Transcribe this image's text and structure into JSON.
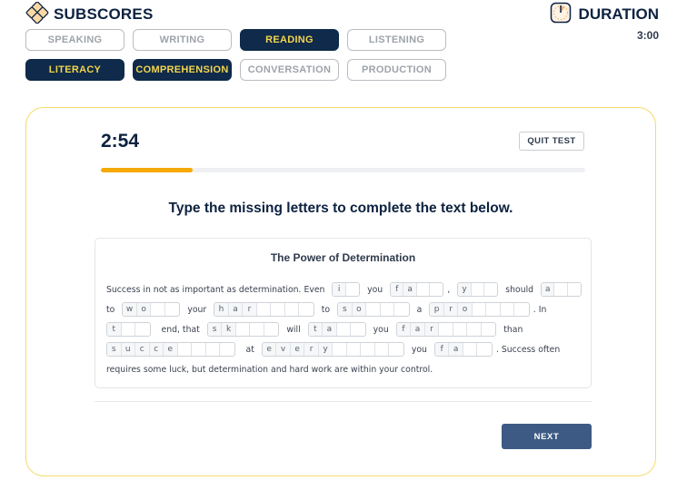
{
  "header": {
    "subscores_title": "SUBSCORES",
    "subscores_icon": "diamond-grid-icon",
    "duration_title": "DURATION",
    "duration_icon": "stopwatch-icon",
    "duration_value": "3:00"
  },
  "pills_row1": [
    {
      "label": "SPEAKING",
      "active": false
    },
    {
      "label": "WRITING",
      "active": false
    },
    {
      "label": "READING",
      "active": true
    },
    {
      "label": "LISTENING",
      "active": false
    }
  ],
  "pills_row2": [
    {
      "label": "LITERACY",
      "active": true
    },
    {
      "label": "COMPREHENSION",
      "active": true
    },
    {
      "label": "CONVERSATION",
      "active": false
    },
    {
      "label": "PRODUCTION",
      "active": false
    }
  ],
  "test": {
    "timer": "2:54",
    "quit_label": "QUIT TEST",
    "progress_fraction": 0.19,
    "instruction": "Type the missing letters to complete the text below.",
    "next_label": "NEXT",
    "colors": {
      "accent": "#f6a900",
      "navy": "#0f2a4a",
      "highlight": "#f3d54e",
      "next": "#3c5a84"
    }
  },
  "passage": {
    "title": "The Power of Determination",
    "lines": [
      [
        {
          "t": "Success in not as important as determination. Even"
        },
        {
          "w": "i",
          "n": 2
        },
        {
          "t": "you"
        },
        {
          "w": "fa",
          "n": 4
        },
        {
          "t": ","
        },
        {
          "w": "y",
          "n": 3
        },
        {
          "t": "should"
        },
        {
          "w": "a",
          "n": 3
        }
      ],
      [
        {
          "t": "to"
        },
        {
          "w": "wo",
          "n": 4
        },
        {
          "t": "your"
        },
        {
          "w": "har",
          "n": 7
        },
        {
          "t": "to"
        },
        {
          "w": "so",
          "n": 5
        },
        {
          "t": "a"
        },
        {
          "w": "pro",
          "n": 7
        },
        {
          "t": ". In"
        }
      ],
      [
        {
          "w": "t",
          "n": 3
        },
        {
          "t": "end, that"
        },
        {
          "w": "sk",
          "n": 5
        },
        {
          "t": "will"
        },
        {
          "w": "ta",
          "n": 4
        },
        {
          "t": "you"
        },
        {
          "w": "far",
          "n": 7
        },
        {
          "t": "than"
        }
      ],
      [
        {
          "w": "succe",
          "n": 9
        },
        {
          "t": "at"
        },
        {
          "w": "every",
          "n": 10
        },
        {
          "t": "you"
        },
        {
          "w": "fa",
          "n": 4
        },
        {
          "t": ". Success often"
        }
      ],
      [
        {
          "t": "requires some luck, but determination and hard work are within your control."
        }
      ]
    ]
  }
}
